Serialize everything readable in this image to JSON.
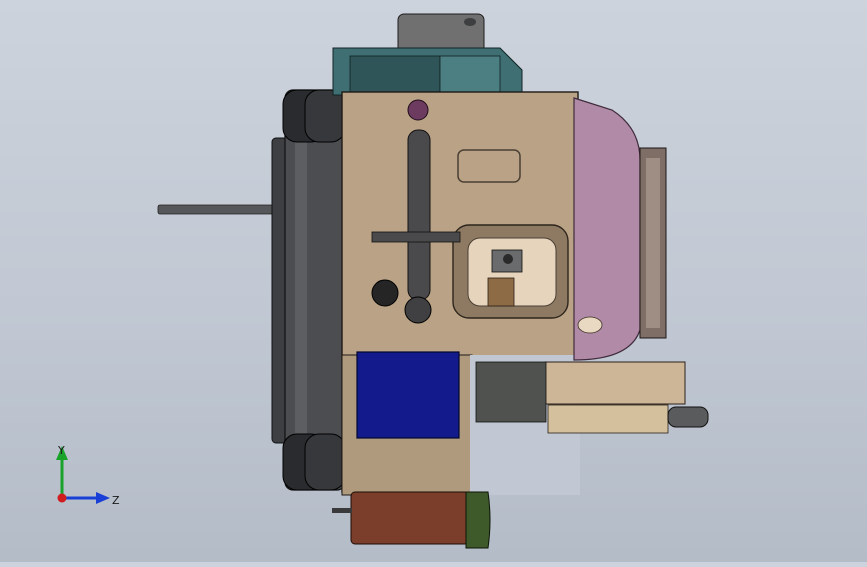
{
  "viewport": {
    "background_top": "#cdd3dc",
    "background_bottom": "#b4bcc8"
  },
  "model": {
    "colors": {
      "body": "#b9a285",
      "body_dark": "#8e7a62",
      "column": "#4b4d51",
      "column_dark": "#2f3033",
      "motor_teal": "#3f6f72",
      "motor_top": "#6f706f",
      "purple": "#b08aa6",
      "purple_dark": "#7e5f77",
      "blue_plate": "#121a8c",
      "brown_base": "#7a3e2a",
      "green_base": "#3f5a2a",
      "tray": "#cdb597",
      "lever": "#4a4a4c"
    }
  },
  "triad": {
    "y_label": "Y",
    "z_label": "Z",
    "colors": {
      "y": "#1aa32a",
      "z": "#1a3fd6",
      "origin": "#d01c1c"
    }
  }
}
